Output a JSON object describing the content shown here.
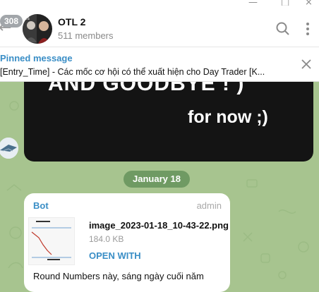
{
  "header": {
    "title": "OTL 2",
    "subtitle": "511 members",
    "unread_count": "308",
    "back_icon": "arrow-left-icon",
    "search_icon": "search-icon",
    "menu_icon": "more-vertical-icon"
  },
  "window": {
    "minimize": "—",
    "maximize": "□",
    "close": "×"
  },
  "pinned": {
    "label": "Pinned message",
    "text": "[Entry_Time]  - Các mốc cơ hội có thể xuất hiện cho Day Trader  [K..."
  },
  "media_message": {
    "line1": "AND GOODBYE  ! )",
    "line2": "for now ;)"
  },
  "date_separator": "January 18",
  "file_message": {
    "sender": "Bot",
    "role": "admin",
    "file_name": "image_2023-01-18_10-43-22.png",
    "file_size": "184.0 KB",
    "open_label": "OPEN WITH",
    "text": "Round Numbers này, sáng ngày cuối năm"
  },
  "colors": {
    "accent": "#3a8ec6",
    "chat_background": "#a7c48f",
    "date_pill": "#6f9a63"
  }
}
